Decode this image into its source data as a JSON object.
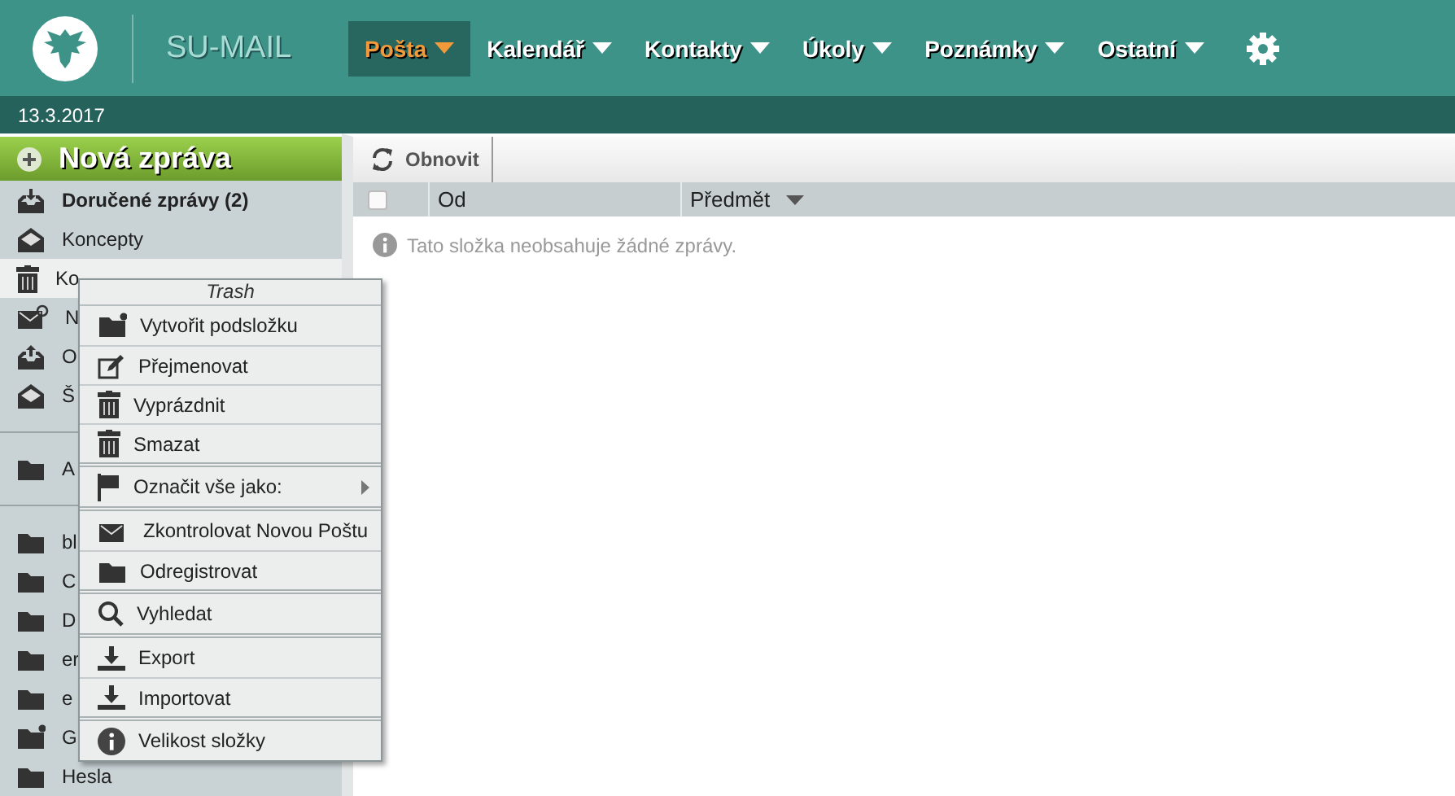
{
  "header": {
    "brand": "SU-MAIL",
    "nav": [
      {
        "label": "Pošta",
        "selected": true
      },
      {
        "label": "Kalendář",
        "selected": false
      },
      {
        "label": "Kontakty",
        "selected": false
      },
      {
        "label": "Úkoly",
        "selected": false
      },
      {
        "label": "Poznámky",
        "selected": false
      },
      {
        "label": "Ostatní",
        "selected": false
      }
    ]
  },
  "date": "13.3.2017",
  "sidebar": {
    "new_message": "Nová zpráva",
    "groups": [
      [
        {
          "label": "Doručené zprávy (2)",
          "unread": true,
          "selected": false
        },
        {
          "label": "Koncepty",
          "unread": false,
          "selected": false
        },
        {
          "label": "Ko",
          "unread": false,
          "selected": true
        },
        {
          "label": "N",
          "unread": false,
          "selected": false
        },
        {
          "label": "O",
          "unread": false,
          "selected": false
        },
        {
          "label": "Š",
          "unread": false,
          "selected": false
        }
      ],
      [
        {
          "label": "A",
          "unread": false,
          "selected": false
        }
      ],
      [
        {
          "label": "bl",
          "unread": false,
          "selected": false
        },
        {
          "label": "C",
          "unread": false,
          "selected": false
        },
        {
          "label": "D",
          "unread": false,
          "selected": false
        },
        {
          "label": "er",
          "unread": false,
          "selected": false
        },
        {
          "label": "e",
          "unread": false,
          "selected": false
        },
        {
          "label": "G",
          "unread": false,
          "selected": false
        },
        {
          "label": "Hesla",
          "unread": false,
          "selected": false
        }
      ]
    ]
  },
  "toolbar": {
    "refresh": "Obnovit"
  },
  "table": {
    "columns": [
      {
        "label": "Od",
        "sorted": false
      },
      {
        "label": "Předmět",
        "sorted": true
      }
    ],
    "select_all": false,
    "empty": "Tato složka neobsahuje žádné zprávy."
  },
  "context_menu": {
    "title": "Trash",
    "groups": [
      [
        {
          "label": "Vytvořit podsložku",
          "submenu": false
        },
        {
          "label": "Přejmenovat",
          "submenu": false
        },
        {
          "label": "Vyprázdnit",
          "submenu": false
        },
        {
          "label": "Smazat",
          "submenu": false
        }
      ],
      [
        {
          "label": "Označit vše jako:",
          "submenu": true
        }
      ],
      [
        {
          "label": "Zkontrolovat Novou Poštu",
          "submenu": false
        },
        {
          "label": "Odregistrovat",
          "submenu": false
        }
      ],
      [
        {
          "label": "Vyhledat",
          "submenu": false
        }
      ],
      [
        {
          "label": "Export",
          "submenu": false
        },
        {
          "label": "Importovat",
          "submenu": false
        }
      ],
      [
        {
          "label": "Velikost složky",
          "submenu": false
        }
      ]
    ]
  }
}
